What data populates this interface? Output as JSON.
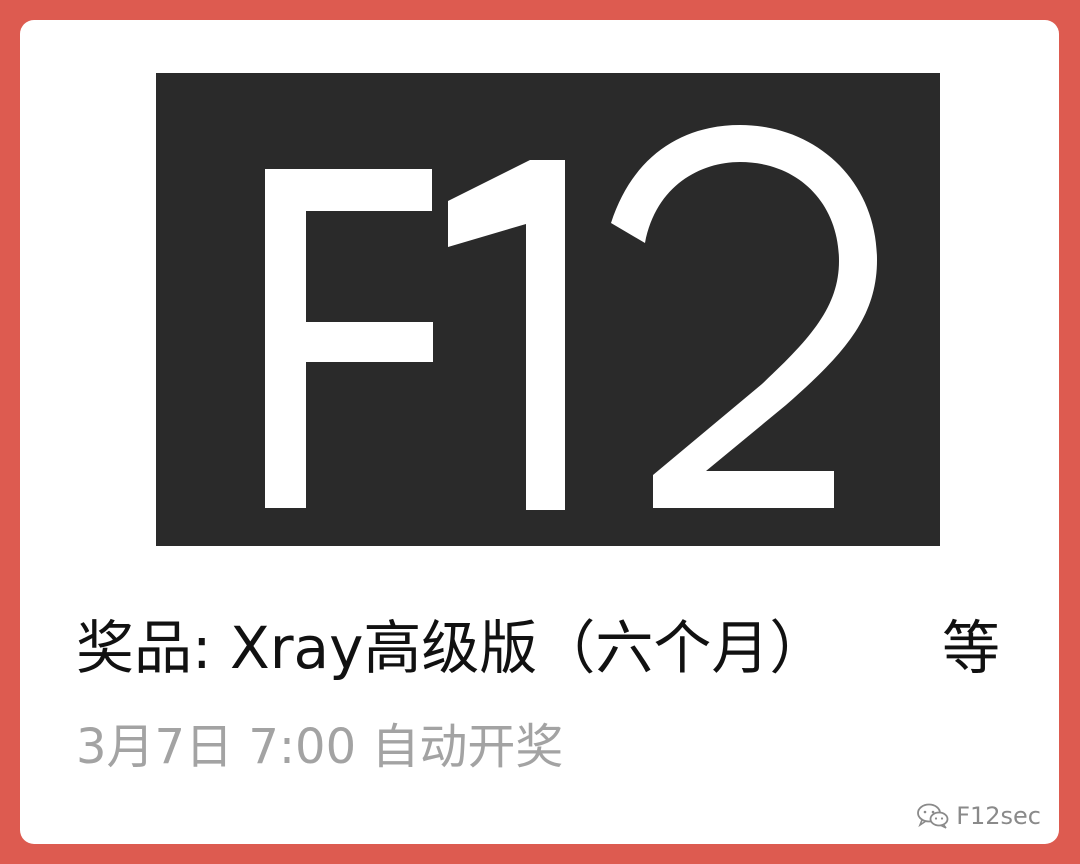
{
  "banner": {
    "logo_text": "F12",
    "background": "#2a2a2a",
    "foreground": "#ffffff"
  },
  "prize": {
    "text": "奖品: Xray高级版（六个月）",
    "suffix": "等"
  },
  "schedule": {
    "text": "3月7日 7:00 自动开奖"
  },
  "watermark": {
    "icon": "wechat-icon",
    "account": "F12sec"
  },
  "colors": {
    "frame": "#dd5b50",
    "card": "#ffffff",
    "text_primary": "#111111",
    "text_secondary": "#a3a3a3"
  }
}
